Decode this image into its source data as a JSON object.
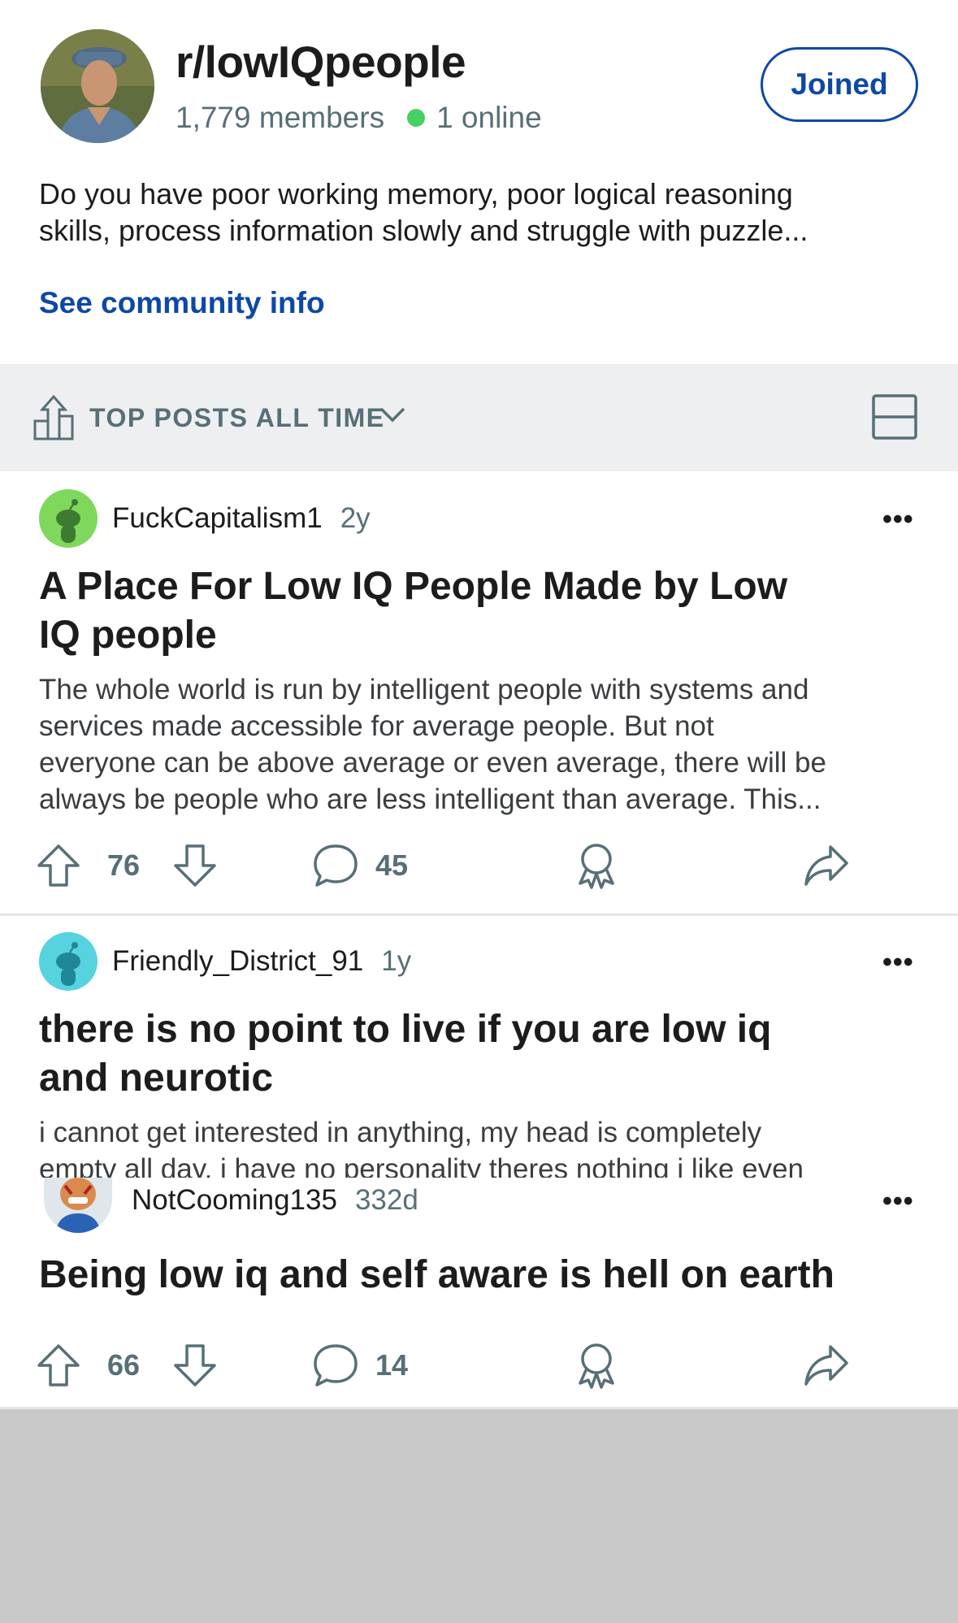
{
  "subreddit": {
    "name": "r/lowIQpeople",
    "members": "1,779 members",
    "online": "1 online",
    "joined_label": "Joined",
    "description_lines": [
      "Do you have poor working memory, poor logical reasoning",
      "skills,  process information slowly and struggle with  puzzle..."
    ],
    "community_link": "See community info"
  },
  "sort": {
    "label": "TOP POSTS ALL TIME",
    "icons": [
      "rank-icon",
      "chevron-down-icon",
      "card-layout-icon"
    ]
  },
  "posts": [
    {
      "author": "FuckCapitalism1",
      "age": "2y",
      "more": "•••",
      "title_lines": [
        "A Place For Low IQ People Made by Low",
        "IQ people"
      ],
      "body_lines": [
        "The whole world is run by intelligent people with systems and",
        "services made accessible for average people. But not",
        "everyone can be above average or even average, there will be",
        "always be people who are less intelligent than average. This..."
      ],
      "votes": "76",
      "comments": "45",
      "avatar_color": "#7fd85c"
    },
    {
      "author": "Friendly_District_91",
      "age": "1y",
      "more": "•••",
      "title_lines": [
        "there is no point to live if you are low iq",
        "and neurotic"
      ],
      "body_lines": [
        "i cannot get interested in anything, my head is completely",
        "empty all day. i have no personality theres nothing i like even"
      ],
      "avatar_color": "#57d3e0"
    },
    {
      "author": "NotCooming135",
      "age": "332d",
      "more": "•••",
      "title_lines": [
        "Being low iq and self aware is hell on earth"
      ],
      "votes": "66",
      "comments": "14"
    }
  ],
  "colors": {
    "accent_blue": "#0d48a6",
    "online_green": "#46d160",
    "meta_grey": "#576f76",
    "sortbar_bg": "#edeff1"
  }
}
